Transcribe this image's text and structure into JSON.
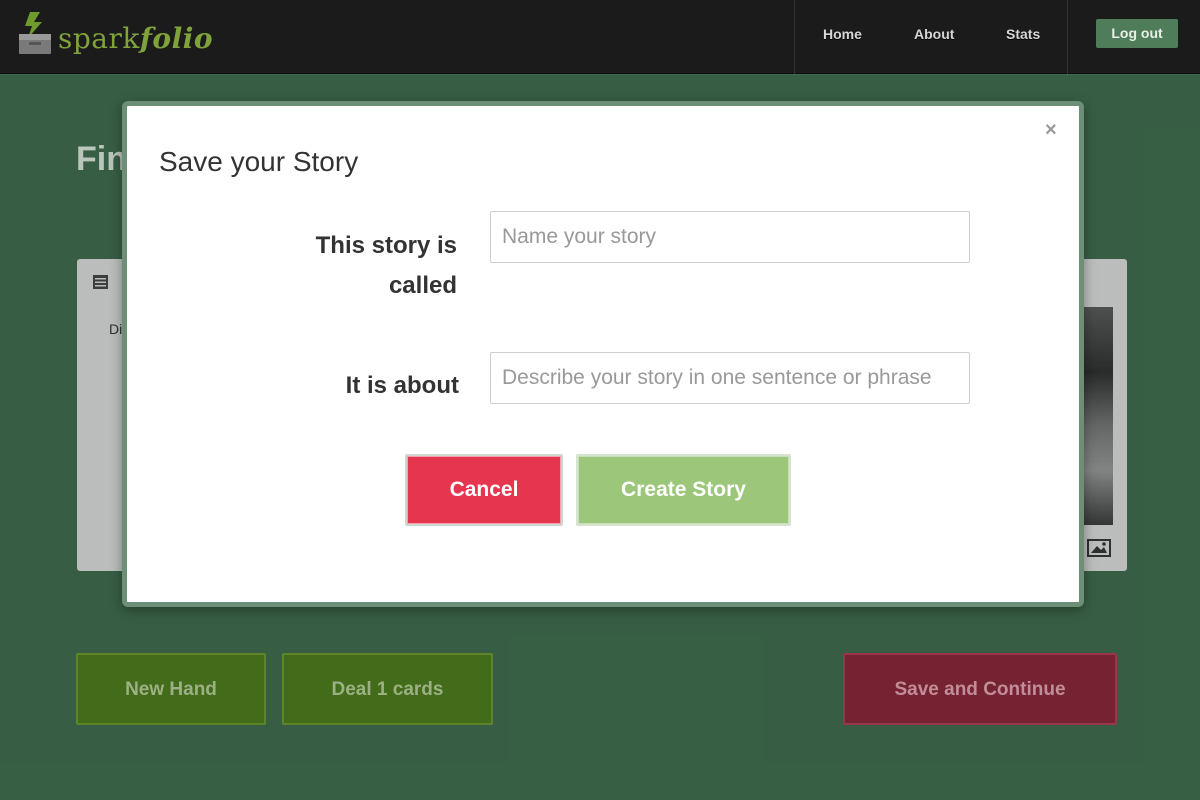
{
  "navbar": {
    "brand_prefix": "spark",
    "brand_suffix": "folio",
    "links": [
      "Home",
      "About",
      "Stats"
    ],
    "logout_label": "Log out"
  },
  "page": {
    "heading": "Fin",
    "card_snippet": "Di"
  },
  "actions": {
    "new_hand_label": "New Hand",
    "deal_label": "Deal 1 cards",
    "save_continue_label": "Save and Continue"
  },
  "modal": {
    "title": "Save your Story",
    "close_symbol": "×",
    "name_label_line1": "This story is",
    "name_label_line2": "called",
    "name_placeholder": "Name your story",
    "name_value": "",
    "about_label": "It is about",
    "about_placeholder": "Describe your story in one sentence or phrase",
    "about_value": "",
    "cancel_label": "Cancel",
    "create_label": "Create Story"
  },
  "icons": {
    "brand": "box-lightning-icon",
    "card_list": "list-icon",
    "card_image": "image-icon",
    "close": "close-icon"
  },
  "colors": {
    "background": "#3f6b4d",
    "navbar": "#1b1b1b",
    "brand": "#7fa33a",
    "cancel": "#e6354f",
    "create": "#9cc77a",
    "green_action": "#4c7a1a",
    "red_action": "#8a2238"
  }
}
